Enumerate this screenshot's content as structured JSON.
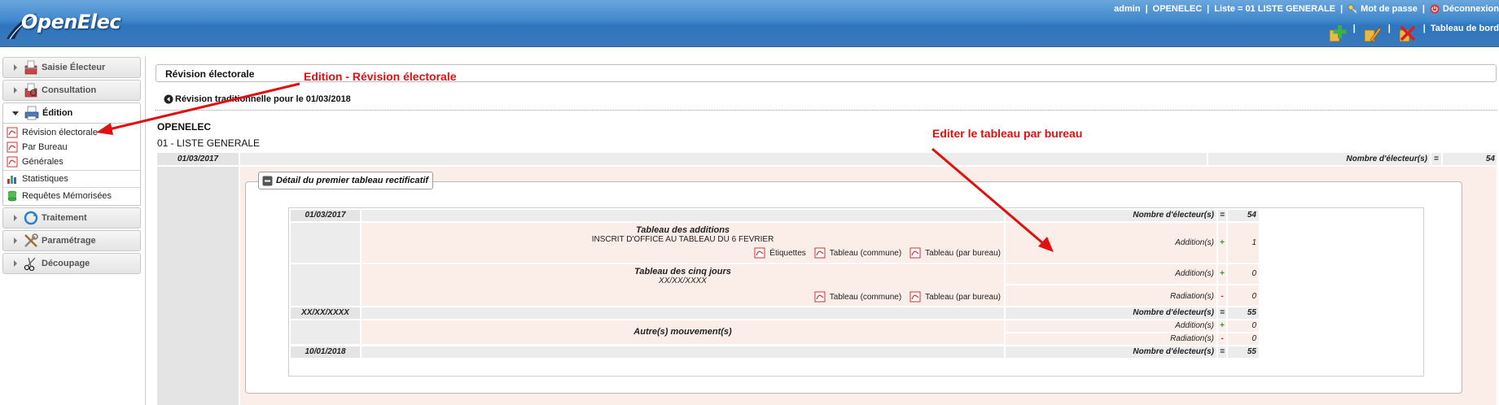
{
  "app": {
    "name": "OpenElec"
  },
  "header": {
    "user": "admin",
    "collectivite": "OPENELEC",
    "liste": "Liste = 01 LISTE GENERALE",
    "password_link": "Mot de passe",
    "logout_link": "Déconnexion",
    "dashboard_link": "Tableau de bord",
    "separator": "|"
  },
  "sidebar": {
    "menus": [
      {
        "label": "Saisie Électeur",
        "icon": "ballot-box-icon"
      },
      {
        "label": "Consultation",
        "icon": "ballot-box-icon"
      },
      {
        "label": "Édition",
        "icon": "printer-icon"
      },
      {
        "label": "Traitement",
        "icon": "refresh-icon"
      },
      {
        "label": "Paramétrage",
        "icon": "tools-icon"
      },
      {
        "label": "Découpage",
        "icon": "scissors-icon"
      }
    ],
    "edition_items": [
      {
        "label": "Révision électorale",
        "icon": "pdf-icon"
      },
      {
        "label": "Par Bureau",
        "icon": "pdf-icon"
      },
      {
        "label": "Générales",
        "icon": "pdf-icon"
      },
      {
        "label": "Statistiques",
        "icon": "stats-icon"
      },
      {
        "label": "Requêtes Mémorisées",
        "icon": "query-icon"
      }
    ]
  },
  "main": {
    "title": "Révision électorale",
    "back_link": "Révision traditionnelle pour le 01/03/2018",
    "collectivite": "OPENELEC",
    "liste": "01 - LISTE GENERALE",
    "summary_row": {
      "date": "01/03/2017",
      "label": "Nombre d'électeur(s)",
      "eq": "=",
      "value": "54"
    },
    "fieldset_legend": "Détail du premier tableau rectificatif",
    "table": {
      "row_start": {
        "date": "01/03/2017",
        "label": "Nombre d'électeur(s)",
        "eq": "=",
        "value": "54"
      },
      "additions": {
        "title": "Tableau des additions",
        "subtitle": "INSCRIT D'OFFICE AU TABLEAU DU 6 FEVRIER",
        "links": [
          "Étiquettes",
          "Tableau (commune)",
          "Tableau (par bureau)"
        ],
        "label": "Addition(s)",
        "sign": "+",
        "value": "1"
      },
      "cinq_jours": {
        "title": "Tableau des cinq jours",
        "subtitle": "XX/XX/XXXX",
        "links": [
          "Tableau (commune)",
          "Tableau (par bureau)"
        ],
        "add_label": "Addition(s)",
        "add_sign": "+",
        "add_value": "0",
        "rad_label": "Radiation(s)",
        "rad_sign": "-",
        "rad_value": "0"
      },
      "row_mid": {
        "date": "XX/XX/XXXX",
        "label": "Nombre d'électeur(s)",
        "eq": "=",
        "value": "55"
      },
      "autres": {
        "title": "Autre(s) mouvement(s)",
        "add_label": "Addition(s)",
        "add_sign": "+",
        "add_value": "0",
        "rad_label": "Radiation(s)",
        "rad_sign": "-",
        "rad_value": "0"
      },
      "row_end": {
        "date": "10/01/2018",
        "label": "Nombre d'électeur(s)",
        "eq": "=",
        "value": "55"
      }
    }
  },
  "annotations": {
    "edition_revision": "Edition - Révision électorale",
    "edit_par_bureau": "Editer le tableau par bureau",
    "color": "#e01010"
  }
}
